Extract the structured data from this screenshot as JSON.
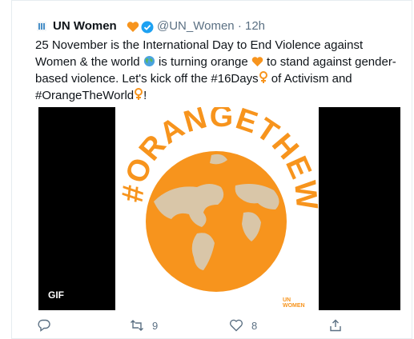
{
  "tweet": {
    "display_name": "UN Women",
    "handle": "@UN_Women",
    "separator": "·",
    "time": "12h",
    "text_parts": [
      "25 November is the International Day to End Violence against Women & the world ",
      " is turning orange ",
      " to stand against gender-based violence. Let's kick off the #16Days",
      " of Activism and #OrangeTheWorld",
      "!"
    ]
  },
  "media": {
    "artwork_text": "#ORANGETHEWORLD",
    "gif_label": "GIF",
    "brand_line1": "UN",
    "brand_line2": "WOMEN",
    "colors": {
      "orange": "#f7941d",
      "land": "#d9c6a8",
      "background": "#000000"
    }
  },
  "actions": {
    "reply_count": "",
    "retweet_count": "9",
    "like_count": "8"
  },
  "icons": [
    "reply-icon",
    "retweet-icon",
    "like-icon",
    "share-icon",
    "verified-icon",
    "orange-heart-icon",
    "globe-icon",
    "female-sign-icon"
  ]
}
